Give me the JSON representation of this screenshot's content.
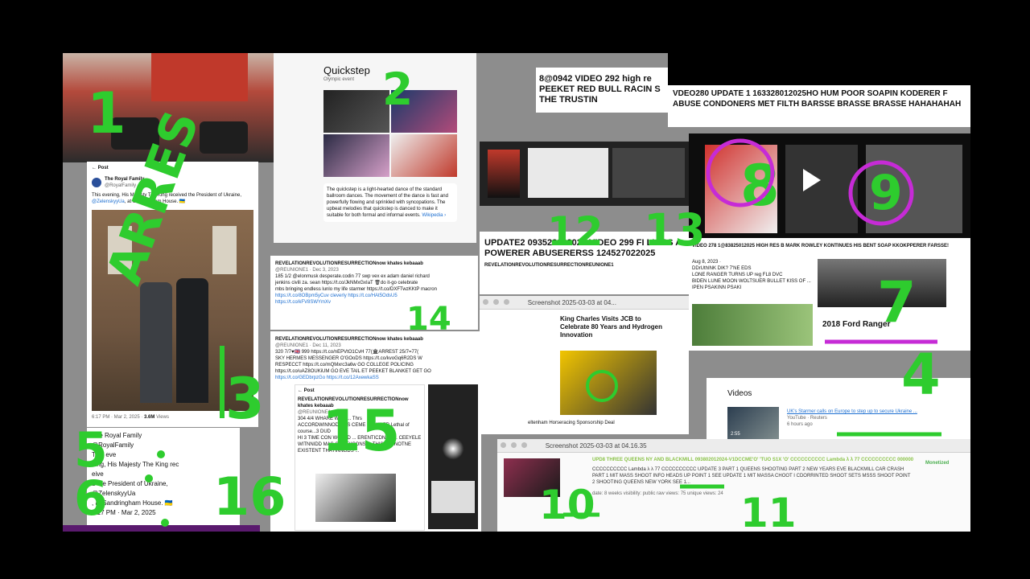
{
  "quickstep": {
    "title": "Quickstep",
    "subtitle": "Olympic event",
    "description": "The quickstep is a light-hearted dance of the standard ballroom dances. The movement of the dance is fast and powerfully flowing and sprinkled with syncopations. The upbeat melodies that quickstep is danced to make it suitable for both formal and informal events.",
    "source_link": "Wikipedia ›"
  },
  "royal_post": {
    "back_label": "Post",
    "account_name": "The Royal Family",
    "handle": "@RoyalFamily",
    "text_a": "This evening, His Majesty The King received the President of Ukraine,",
    "mention": "@ZelenskyyUa",
    "text_b": ", at Sandringham House. 🇺🇦",
    "timestamp": "6:17 PM · Mar 2, 2025 ·",
    "views": "3.6M",
    "views_label": "Views"
  },
  "royal_text_block": {
    "lines": [
      "The Royal Family",
      "@RoyalFamily",
      "This eve",
      "ning, His Majesty The King rec",
      "eive",
      "d the President of Ukraine,",
      "@ZelenskyyUa",
      ", at Sandringham House. 🇺🇦",
      "6:17 PM · Mar 2, 2025"
    ]
  },
  "rev_tweet_1": {
    "name": "REVELATIONREVOLUTIONRESURRECTIONnow khates kebaaab",
    "meta": "@REUNIONE1 · Dec 3, 2023",
    "line1": "185  1/2 @elonmusk desperate.codin 77 swp vex ex adam daniel richard",
    "line2": "jenkins civili za. sean https://t.co/JkNMxGxIaT 🗑do it-go celebrate",
    "line3": "mbs bringing endless lunlo my life starmer https://t.co/DXFTwzKKtP macron",
    "line4": "https://t.co/8OBpm5yCuv  cleverly https://t.co/HAt5OdsU5",
    "line5": "https://t.co/kFV8SWYmXv"
  },
  "rev_tweet_2": {
    "name": "REVELATIONREVOLUTIONRESURRECTIONnow khates kebaaab",
    "meta": "@REUNIONE1 · Dec 11, 2023",
    "line1": "320 7/7♥🇬🇧 999 https://t.co/nEPVtO1CvH 77(🏛ARREST 25/7=77(",
    "line2": "SKY HERMES MESSENGER O'GOoDS https://t.co/kvoGq6R2DS  W",
    "line3": "RESPECCT https://t.co/mQMxrc3a6w  GO COLLEGE  POLICING",
    "line4": "https://t.co/uAZ8OUKiUM GO EVE TAIL ET PEEKET BLANKET GET GO",
    "line5": "https://t.co/GEDbrpzGo  https://t.co/12AxewkaSS"
  },
  "rev_post": {
    "back_label": "Post",
    "name": "REVELATIONREVOLUTIONRESURRECTIONnow khates kebaaab",
    "handle": "@REUNIONE1",
    "body1": "304 4/4 WHARE WOZ ... Thrs",
    "body2": "ACCORDWINNOD CDS CEME ... UNDER  Lethal of course...3 DUD",
    "body3": "HI 3 TIME CON WORLD ... ERENTICDNSS ... CEEYELE",
    "body4": "WITNNIDD MAS CODFYCONS ... THIS T ... NOTNE",
    "body5": "EXISTENT THAYINNGDS ..."
  },
  "headline_video292": {
    "line1": "8@0942 VIDEO 292 high re",
    "line2": "PEEKET RED BULL RACIN S",
    "line3": "THE TRUSTIN"
  },
  "headline_video280": {
    "line1": "VDEO280 UPDATE 1 163328012025HO HUM POOR SOAPIN KODERER F",
    "line2": "ABUSE CONDONERS MET FILTH BARSSE BRASSE BRASSE HAHAHAHAH"
  },
  "headline_update2": {
    "line1": "UPDATE2 093528022025 VIDEO 299 FI LIARS A",
    "line2": "POWERER ABUSERERSS 124527022025",
    "channel": "REVELATIONREVOLUTIONRESURRECTIONREUNIONE1"
  },
  "headline_video278": {
    "line1": "VIDEO 278 1@83825012025 HIGH RES B MARK ROWLEY KONTINUES HIS BENT SOAP KKOKPPERER FARSSE!"
  },
  "screenshot_window_1": {
    "title": "Screenshot 2025-03-03 at 04..."
  },
  "jcb_article": {
    "headline": "King Charles Visits JCB to Celebrate 80 Years and Hydrogen Innovation",
    "caption": "eltenham Horseracing Sponsorship Deal"
  },
  "ford_ranger": {
    "label": "2018 Ford Ranger",
    "date_line": "Aug 8, 2023 ·",
    "line1": "DDrUthINK DIK? 7'NE EDS",
    "line2": "LONE RANGER TURNS UP reg FL8 DVC",
    "line3": "BIDEN LUNE MOON WOLTSUER BULLET KISS OF ...",
    "line4": "IPEN PSAKINN PSAKI"
  },
  "videos_card": {
    "heading": "Videos",
    "title": "UK's Starmer calls on Europe to step up to secure Ukraine ...",
    "source": "YouTube · Reuters",
    "age": "6 hours ago",
    "duration": "2:55"
  },
  "screenshot_window_2": {
    "title": "Screenshot 2025-03-03 at 04.16.35",
    "video_title": "UPD8 THREE QUEENS NY AND BLACKMILL 093802012024-V1DCCME'O' 'TUO S1X 'O' CCCCCCCCCC Lambda λ λ 77 CCCCCCCCCC 000000",
    "badge": "Monetized",
    "description": "CCCCCCCCCC Lambda λ λ 77 CCCCCCCCCC UPDATE 3 PART 1 QUEENS SHOOTING PART 2 NEW YEARS EVE BLACKMILL CAR CRASH PART 1 MIT MASS SHOOT INFO HEADS UP POINT 1 SEE UPDATE 1 MIT MASSA CHOOT I CDORRINTED SHOOT SETS MSSS SHOOT POINT 2 SHOOTING QUEENS NEW YORK SEE 1...",
    "stats": "date: 8 weeks  visibility: public  raw views: 75  unique views: 24"
  },
  "annotations": {
    "n1": "1",
    "n2": "2",
    "n3": "3",
    "n4": "4",
    "n5": "5",
    "n6": "6",
    "n7": "7",
    "n8": "8",
    "n9": "9",
    "n10": "10",
    "n11": "11",
    "n12": "12",
    "n13": "13",
    "n14": "14",
    "n15": "15",
    "n16": "16",
    "arrest_text": "ARRES",
    "annot_color": "#2ecc2e",
    "annot_purple": "#c62bd6"
  },
  "colors": {
    "background": "#000000",
    "stage": "#8d8d8d",
    "link": "#1d6fd1",
    "monetized_green": "#4caf50",
    "headline_green": "#8bc34a"
  }
}
